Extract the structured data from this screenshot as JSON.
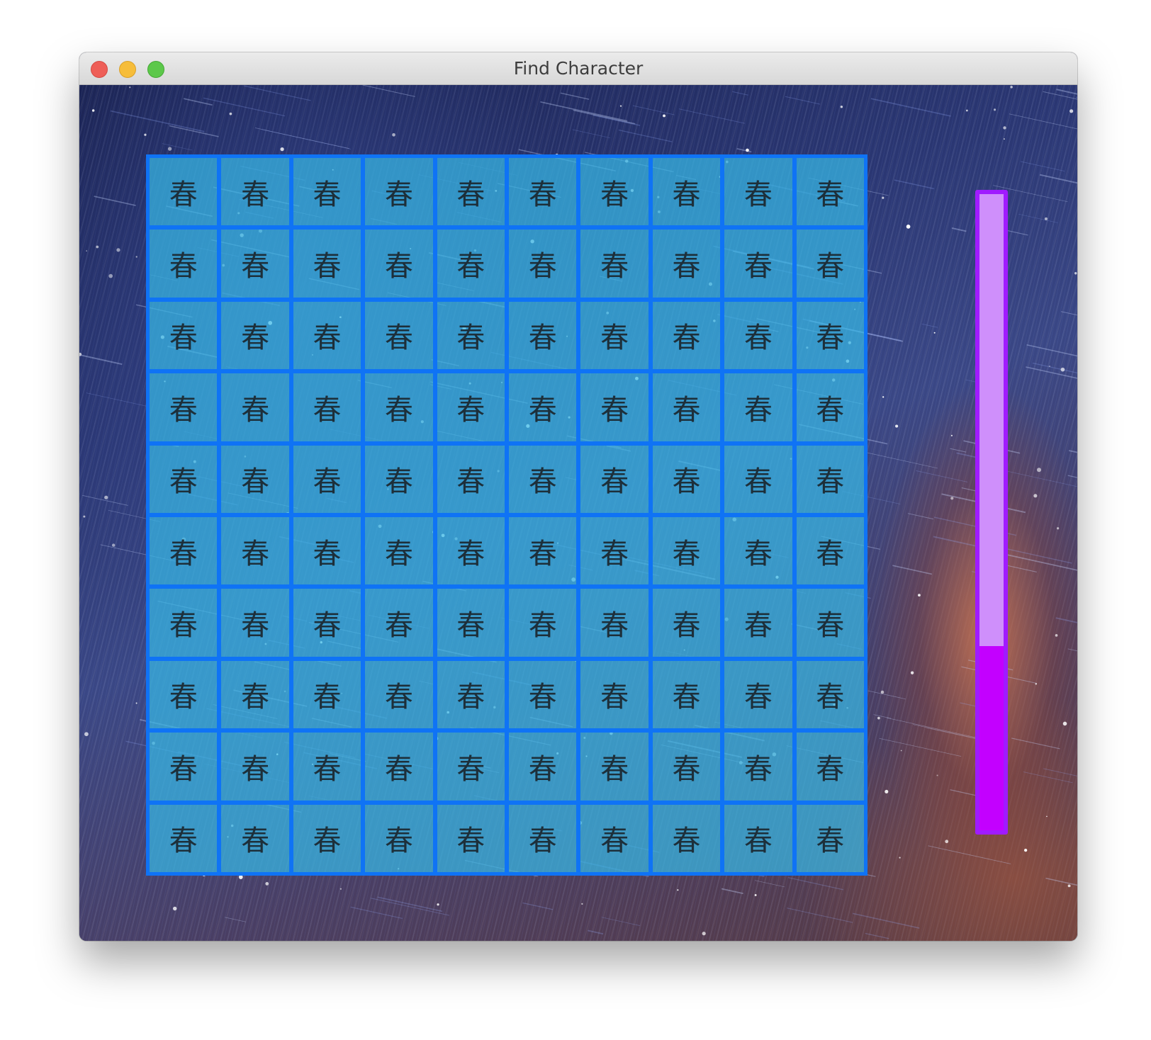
{
  "window": {
    "title": "Find Character"
  },
  "game": {
    "rows": 10,
    "columns": 10,
    "character": "春",
    "cell_color": "#38b9e6",
    "border_color": "#0f73f5"
  },
  "timer": {
    "remaining_fraction": 0.29,
    "track_color": "#cf8ffb",
    "fill_color": "#c300ff",
    "border_color": "#a01bff"
  }
}
